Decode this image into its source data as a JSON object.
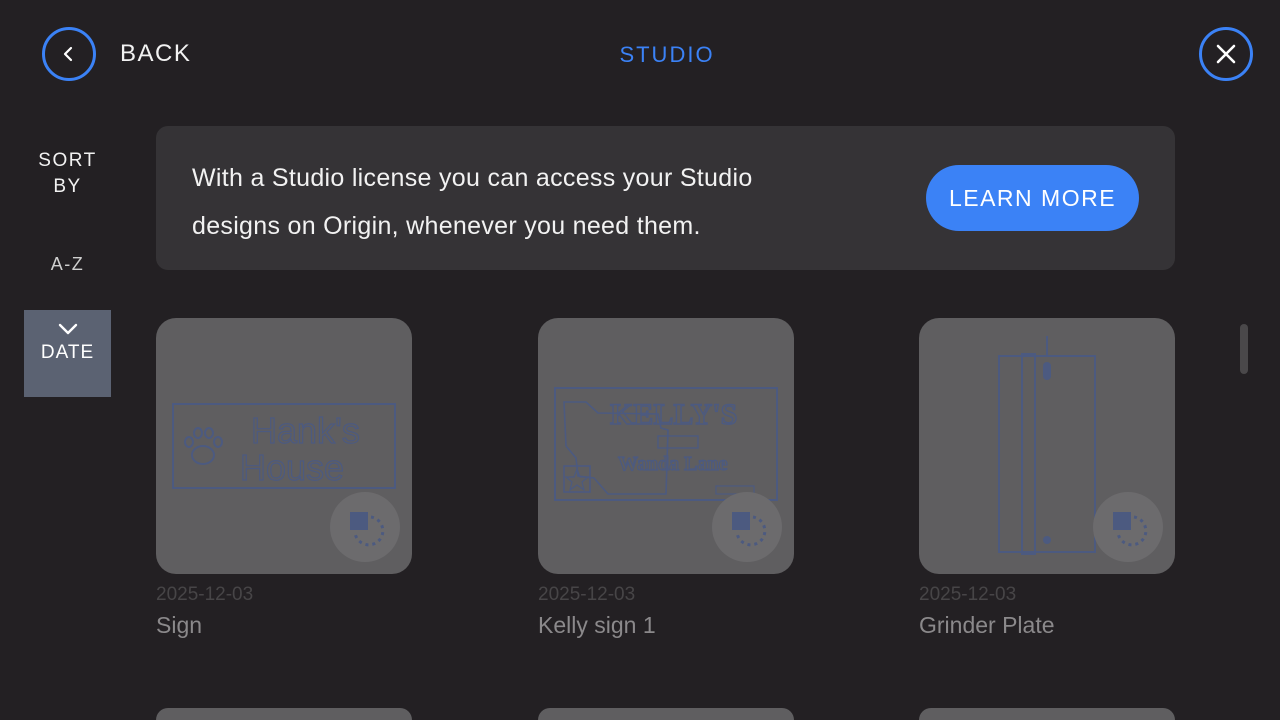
{
  "header": {
    "back_label": "BACK",
    "title": "STUDIO"
  },
  "sort": {
    "title_line1": "SORT",
    "title_line2": "BY",
    "options": [
      {
        "label": "A-Z",
        "selected": false
      },
      {
        "label": "DATE",
        "selected": true
      }
    ]
  },
  "banner": {
    "line1": "With a Studio license you can access your Studio",
    "line2": "designs on Origin, whenever you need them.",
    "button_label": "LEARN MORE"
  },
  "designs": [
    {
      "date": "2025-12-03",
      "name": "Sign",
      "thumb_text_1": "Hank's",
      "thumb_text_2": "House"
    },
    {
      "date": "2025-12-03",
      "name": "Kelly sign  1",
      "thumb_text_1": "KELLY'S",
      "thumb_text_2": "Wanda Lane"
    },
    {
      "date": "2025-12-03",
      "name": "Grinder Plate"
    }
  ],
  "colors": {
    "accent": "#3b82f6",
    "background": "#232023",
    "banner": "#353336",
    "selected_sort": "#5b6272"
  },
  "icons": {
    "back": "chevron-left-icon",
    "close": "close-icon",
    "sort_direction": "chevron-down-icon",
    "studio_badge": "studio-icon"
  }
}
